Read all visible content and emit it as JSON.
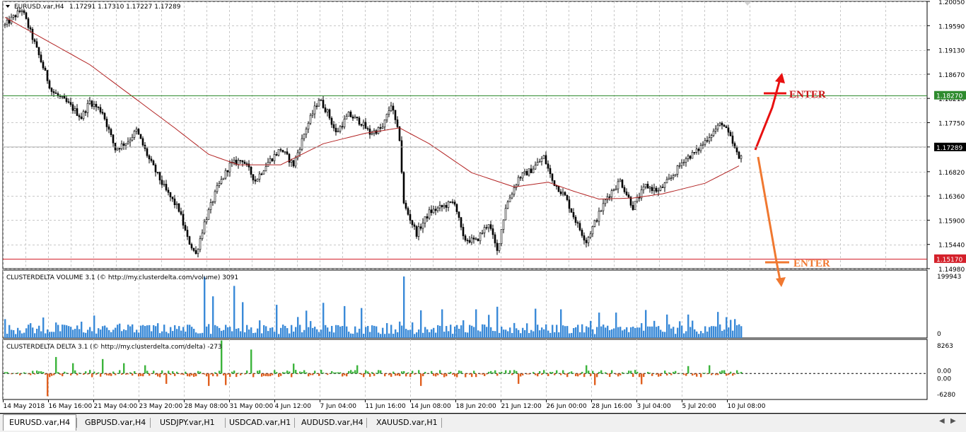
{
  "colors": {
    "background": "#ffffff",
    "grid": "#c8c8c8",
    "candle": "#000000",
    "ma": "#b22222",
    "resistance_line": "#2e8b2e",
    "support_line": "#d4202a",
    "volume_bar": "#3a8ad8",
    "delta_pos": "#3cb43c",
    "delta_neg": "#e06020",
    "arrow_up": "#e81010",
    "arrow_down": "#f07830",
    "enter_up_text": "#c81414",
    "enter_down_text": "#f07830"
  },
  "chart_data": [
    {
      "type": "candlestick",
      "title": "EURUSD.var,H4",
      "ohlc_readout": "1.17291 1.17310 1.17227 1.17289",
      "ylim": [
        1.1498,
        1.2005
      ],
      "y_ticks": [
        "1.20050",
        "1.19590",
        "1.19130",
        "1.18670",
        "1.18210",
        "1.17750",
        "1.17289",
        "1.16820",
        "1.16360",
        "1.15900",
        "1.15440",
        "1.14980"
      ],
      "x_ticks": [
        "14 May 2018",
        "16 May 16:00",
        "21 May 04:00",
        "23 May 20:00",
        "28 May 08:00",
        "31 May 00:00",
        "4 Jun 12:00",
        "7 Jun 04:00",
        "11 Jun 16:00",
        "14 Jun 08:00",
        "18 Jun 20:00",
        "21 Jun 12:00",
        "26 Jun 00:00",
        "28 Jun 16:00",
        "3 Jul 04:00",
        "5 Jul 20:00",
        "10 Jul 08:00"
      ],
      "price_path": [
        [
          0,
          1.196
        ],
        [
          8,
          1.199
        ],
        [
          14,
          1.1925
        ],
        [
          22,
          1.1835
        ],
        [
          30,
          1.181
        ],
        [
          36,
          1.1785
        ],
        [
          40,
          1.1815
        ],
        [
          46,
          1.1795
        ],
        [
          52,
          1.1725
        ],
        [
          58,
          1.174
        ],
        [
          62,
          1.176
        ],
        [
          68,
          1.1705
        ],
        [
          76,
          1.1645
        ],
        [
          82,
          1.161
        ],
        [
          86,
          1.1555
        ],
        [
          90,
          1.1525
        ],
        [
          94,
          1.1585
        ],
        [
          100,
          1.165
        ],
        [
          106,
          1.1695
        ],
        [
          112,
          1.1705
        ],
        [
          118,
          1.1665
        ],
        [
          124,
          1.17
        ],
        [
          130,
          1.1725
        ],
        [
          136,
          1.1695
        ],
        [
          142,
          1.1765
        ],
        [
          148,
          1.182
        ],
        [
          152,
          1.1795
        ],
        [
          156,
          1.1755
        ],
        [
          162,
          1.179
        ],
        [
          168,
          1.1775
        ],
        [
          172,
          1.1755
        ],
        [
          178,
          1.1765
        ],
        [
          182,
          1.181
        ],
        [
          186,
          1.1745
        ],
        [
          188,
          1.162
        ],
        [
          194,
          1.1565
        ],
        [
          200,
          1.1605
        ],
        [
          206,
          1.1615
        ],
        [
          212,
          1.1625
        ],
        [
          216,
          1.1555
        ],
        [
          222,
          1.155
        ],
        [
          228,
          1.1585
        ],
        [
          232,
          1.153
        ],
        [
          236,
          1.1615
        ],
        [
          242,
          1.167
        ],
        [
          248,
          1.1685
        ],
        [
          254,
          1.171
        ],
        [
          258,
          1.1665
        ],
        [
          264,
          1.1635
        ],
        [
          270,
          1.158
        ],
        [
          274,
          1.155
        ],
        [
          278,
          1.1585
        ],
        [
          284,
          1.1635
        ],
        [
          290,
          1.1665
        ],
        [
          296,
          1.1615
        ],
        [
          302,
          1.1655
        ],
        [
          308,
          1.1645
        ],
        [
          314,
          1.167
        ],
        [
          320,
          1.1705
        ],
        [
          326,
          1.172
        ],
        [
          332,
          1.175
        ],
        [
          338,
          1.1775
        ],
        [
          342,
          1.1745
        ],
        [
          346,
          1.1705
        ],
        [
          348,
          1.1729
        ]
      ],
      "moving_average": [
        [
          0,
          1.1975
        ],
        [
          20,
          1.193
        ],
        [
          40,
          1.1885
        ],
        [
          60,
          1.1825
        ],
        [
          80,
          1.1765
        ],
        [
          96,
          1.1715
        ],
        [
          110,
          1.1695
        ],
        [
          130,
          1.1695
        ],
        [
          150,
          1.1735
        ],
        [
          170,
          1.1755
        ],
        [
          186,
          1.1765
        ],
        [
          200,
          1.1735
        ],
        [
          220,
          1.168
        ],
        [
          240,
          1.1653
        ],
        [
          256,
          1.1662
        ],
        [
          268,
          1.1645
        ],
        [
          280,
          1.163
        ],
        [
          296,
          1.1632
        ],
        [
          310,
          1.164
        ],
        [
          330,
          1.166
        ],
        [
          346,
          1.1693
        ]
      ],
      "levels": [
        {
          "price": 1.1827,
          "label": "1.18270"
        },
        {
          "price": 1.1517,
          "label": "1.15170"
        }
      ],
      "current_price_label": "1.17289",
      "annotations": [
        "ENTER",
        "ENTER"
      ]
    },
    {
      "type": "bar",
      "title": "CLUSTERDELTA VOLUME 3.1 (© http://my.clusterdelta.com/volume) 3091",
      "y_ticks": [
        "199943",
        "0"
      ],
      "ylim": [
        0,
        199943
      ],
      "bars_count": 348,
      "peak_values": [
        [
          94,
          188000
        ],
        [
          98,
          128000
        ],
        [
          108,
          160000
        ],
        [
          112,
          110000
        ],
        [
          128,
          102000
        ],
        [
          142,
          84000
        ],
        [
          150,
          108000
        ],
        [
          160,
          98000
        ],
        [
          168,
          92000
        ],
        [
          188,
          189000
        ],
        [
          196,
          85000
        ],
        [
          206,
          88000
        ],
        [
          222,
          88000
        ],
        [
          232,
          96000
        ],
        [
          250,
          90000
        ],
        [
          262,
          88000
        ],
        [
          280,
          78000
        ],
        [
          288,
          78000
        ],
        [
          302,
          86000
        ],
        [
          312,
          72000
        ],
        [
          322,
          72000
        ],
        [
          336,
          80000
        ],
        [
          340,
          64000
        ],
        [
          344,
          58000
        ]
      ]
    },
    {
      "type": "bar",
      "title": "CLUSTERDELTA DELTA 3.1 (© http://my.clusterdelta.com/delta) -273",
      "y_ticks": [
        "8263",
        "0.00",
        "0.00",
        "-6280"
      ],
      "ylim": [
        -6280,
        8263
      ],
      "bars_count": 348,
      "peak_values": [
        [
          20,
          -5500
        ],
        [
          24,
          4000
        ],
        [
          32,
          2500
        ],
        [
          46,
          3500
        ],
        [
          56,
          2500
        ],
        [
          66,
          2000
        ],
        [
          76,
          -2500
        ],
        [
          96,
          -3000
        ],
        [
          102,
          8000
        ],
        [
          104,
          -2800
        ],
        [
          116,
          5800
        ],
        [
          136,
          2400
        ],
        [
          166,
          2000
        ],
        [
          196,
          -3000
        ],
        [
          242,
          -2500
        ],
        [
          274,
          2000
        ],
        [
          278,
          -2800
        ],
        [
          300,
          -2600
        ],
        [
          322,
          1800
        ],
        [
          332,
          2000
        ]
      ]
    }
  ],
  "tabs": [
    {
      "label": "EURUSD.var,H4",
      "active": true
    },
    {
      "label": "GBPUSD.var,H4",
      "active": false
    },
    {
      "label": "USDJPY.var,H1",
      "active": false
    },
    {
      "label": "USDCAD.var,H1",
      "active": false
    },
    {
      "label": "AUDUSD.var,H4",
      "active": false
    },
    {
      "label": "XAUUSD.var,H1",
      "active": false
    }
  ]
}
